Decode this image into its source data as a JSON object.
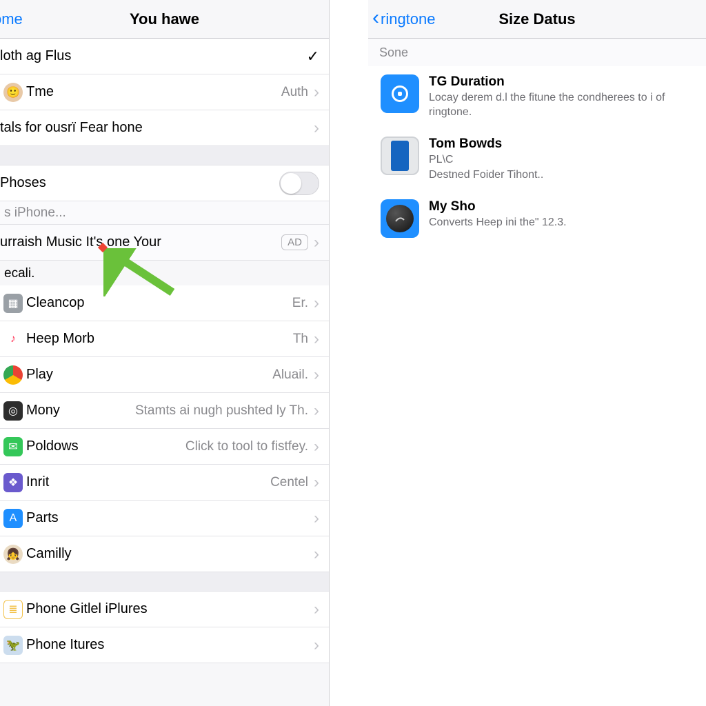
{
  "left": {
    "nav": {
      "back": "ome",
      "title": "You hawe"
    },
    "rows_a": [
      {
        "icon": null,
        "label": "loth ag Flus",
        "detail": "",
        "mark": "check"
      },
      {
        "icon": "avatar",
        "label": "Tme",
        "detail": "Auth",
        "mark": "chev"
      },
      {
        "icon": null,
        "label": "tals for ousrï Fear hone",
        "detail": "",
        "mark": "chev"
      }
    ],
    "toggle_row": {
      "label": "Phoses"
    },
    "placeholder": "s iPhone...",
    "highlight_row": {
      "label": "urraish Music It's one Your",
      "badge": "AD"
    },
    "group_title": "ecali.",
    "rows_b": [
      {
        "icon": "gray",
        "label": "Cleancop",
        "detail": "Er."
      },
      {
        "icon": "music",
        "label": "Heep Morb",
        "detail": "Th"
      },
      {
        "icon": "chrome",
        "label": "Play",
        "detail": "Aluail."
      },
      {
        "icon": "camera",
        "label": "Mony",
        "detail": "Stamts ai nugh pushted ly Th."
      },
      {
        "icon": "msg",
        "label": "Poldows",
        "detail": "Click to tool to fistfey."
      },
      {
        "icon": "purple",
        "label": "Inrit",
        "detail": "Centel"
      },
      {
        "icon": "appstore",
        "label": "Parts",
        "detail": ""
      },
      {
        "icon": "avatar2",
        "label": "Camilly",
        "detail": ""
      }
    ],
    "rows_c": [
      {
        "icon": "notes",
        "label": "Phone Gitlel iPlures"
      },
      {
        "icon": "dino",
        "label": "Phone Itures"
      }
    ]
  },
  "right": {
    "nav": {
      "back": "ringtone",
      "title": "Size Datus"
    },
    "section": "Sone",
    "items": [
      {
        "icon": "blue-square",
        "title": "TG Duration",
        "sub": "Locay derem d.l the fitune the condherees to i of ringtone."
      },
      {
        "icon": "phone-img",
        "title": "Tom Bowds",
        "sub": "PL\\C",
        "sub2": "Destned Foider Tihont.."
      },
      {
        "icon": "dark-circle",
        "title": "My Sho",
        "sub": "Converts Heep ini the\" 12.3."
      }
    ]
  }
}
